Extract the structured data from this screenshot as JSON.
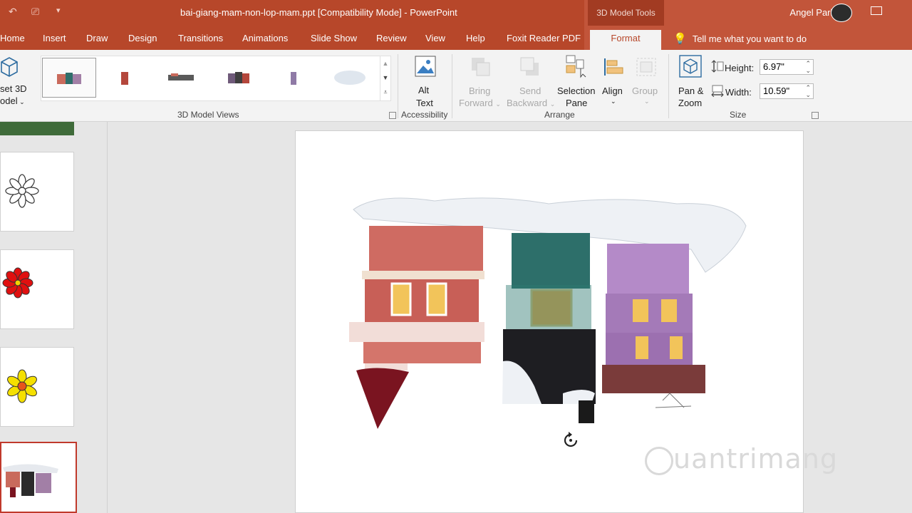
{
  "title_bar": {
    "document_title": "bai-giang-mam-non-lop-mam.ppt [Compatibility Mode]  -  PowerPoint",
    "contextual_group": "3D Model Tools",
    "user_name": "Angel Park"
  },
  "tabs": [
    "Home",
    "Insert",
    "Draw",
    "Design",
    "Transitions",
    "Animations",
    "Slide Show",
    "Review",
    "View",
    "Help",
    "Foxit Reader PDF",
    "Format"
  ],
  "active_tab": "Format",
  "tell_me": "Tell me what you want to do",
  "ribbon": {
    "reset_label_1": "set 3D",
    "reset_label_2": "odel",
    "views_group": "3D Model Views",
    "alt_text_1": "Alt",
    "alt_text_2": "Text",
    "accessibility_group": "Accessibility",
    "bring_forward_1": "Bring",
    "bring_forward_2": "Forward",
    "send_backward_1": "Send",
    "send_backward_2": "Backward",
    "selection_pane_1": "Selection",
    "selection_pane_2": "Pane",
    "align": "Align",
    "group": "Group",
    "arrange_group": "Arrange",
    "pan_zoom_1": "Pan &",
    "pan_zoom_2": "Zoom",
    "height_label": "Height:",
    "height_value": "6.97\"",
    "width_label": "Width:",
    "width_value": "10.59\"",
    "size_group": "Size"
  },
  "watermark": "uantrimang",
  "colors": {
    "accent": "#b7472a",
    "ribbon_bg": "#f3f3f3",
    "selection": "#c0392b"
  }
}
